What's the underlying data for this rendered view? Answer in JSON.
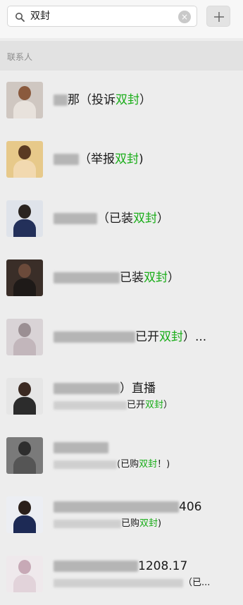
{
  "search": {
    "query": "双封",
    "clear_glyph": "×"
  },
  "section": {
    "title": "联系人"
  },
  "colors": {
    "highlight": "#1aad19"
  },
  "contacts": [
    {
      "pre": "",
      "mid": "那（投诉",
      "hl": "双封",
      "post": "）",
      "pre_w": 20,
      "avatar": [
        "#cfc7c1",
        "#8a5a3d",
        "#e8e2dc"
      ]
    },
    {
      "pre": "",
      "mid": "（举报",
      "hl": "双封",
      "post": ")",
      "pre_w": 36,
      "avatar": [
        "#e7c98a",
        "#5a3a22",
        "#f2d9b0"
      ]
    },
    {
      "pre": "",
      "mid": "（已装",
      "hl": "双封",
      "post": "）",
      "pre_w": 62,
      "avatar": [
        "#dfe3ea",
        "#2a2420",
        "#23305a"
      ]
    },
    {
      "pre": "",
      "mid": "已装",
      "hl": "双封",
      "post": "）",
      "pre_w": 94,
      "avatar": [
        "#3a2e28",
        "#6b4a3a",
        "#1e1a18"
      ]
    },
    {
      "pre": "",
      "mid": "已开",
      "hl": "双封",
      "post": "）...",
      "pre_w": 116,
      "avatar": [
        "#d9d3d6",
        "#9b8f93",
        "#c2b6bb"
      ]
    },
    {
      "l1_mid": "）直播",
      "l1_w": 94,
      "l2_mid": "已开",
      "l2_hl": "双封",
      "l2_post": "）",
      "l2_w": 104,
      "avatar": [
        "#e6e6e6",
        "#3b2a22",
        "#2c2c2c"
      ]
    },
    {
      "l1_mid": "",
      "l1_w": 78,
      "l2_mid": "(已购",
      "l2_hl": "双封",
      "l2_post": "！)",
      "l2_w": 90,
      "avatar": [
        "#7a7a7a",
        "#2e2e2e",
        "#555555"
      ]
    },
    {
      "l1_mid": "406",
      "l1_w": 178,
      "l2_mid": "已购",
      "l2_hl": "双封",
      "l2_post": ")",
      "l2_w": 96,
      "avatar": [
        "#eceef3",
        "#2a1f1a",
        "#1d2a55"
      ]
    },
    {
      "l1_mid": "1208.17",
      "l1_w": 120,
      "l2_mid": "（已...",
      "l2_hl": "",
      "l2_post": "",
      "l2_w": 184,
      "avatar": [
        "#efe9ec",
        "#c7a9b6",
        "#e2d3da"
      ]
    }
  ]
}
